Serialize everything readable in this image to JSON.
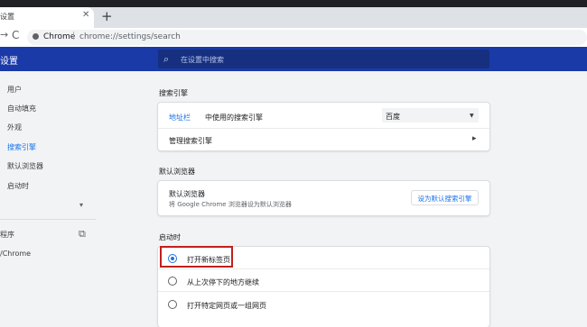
{
  "tab": {
    "title": "设置",
    "close_glyph": "✕",
    "new_tab_glyph": "+"
  },
  "toolbar": {
    "back_glyph": "→",
    "reload_glyph": "C",
    "url_origin": "Chrome",
    "url_sep": "|",
    "url_path": "chrome://settings/search"
  },
  "header": {
    "title": "设置",
    "search_placeholder": "在设置中搜索"
  },
  "sidebar": {
    "items": [
      {
        "label": "用户"
      },
      {
        "label": "自动填充"
      },
      {
        "label": "外观"
      },
      {
        "label": "搜索引擎",
        "selected": true
      },
      {
        "label": "默认浏览器"
      },
      {
        "label": "启动时"
      }
    ],
    "expand_glyph": "▾",
    "apps_label": "程序",
    "about_label": "/Chrome"
  },
  "search_engine": {
    "heading": "搜索引擎",
    "address_bar_link": "地址栏",
    "address_bar_rest": "中使用的搜索引擎",
    "selected_engine": "百度",
    "manage_label": "管理搜索引擎"
  },
  "default_browser": {
    "heading": "默认浏览器",
    "label": "默认浏览器",
    "sublabel": "将 Google Chrome 浏览器设为默认浏览器",
    "button_label": "设为默认搜索引擎"
  },
  "on_startup": {
    "heading": "启动时",
    "options": [
      {
        "label": "打开新标签页",
        "selected": true
      },
      {
        "label": "从上次停下的地方继续",
        "selected": false
      },
      {
        "label": "打开特定网页或一组网页",
        "selected": false
      }
    ]
  },
  "colors": {
    "header_blue": "#1a3aa8",
    "accent": "#1a73e8",
    "highlight_red": "#c0201e"
  }
}
